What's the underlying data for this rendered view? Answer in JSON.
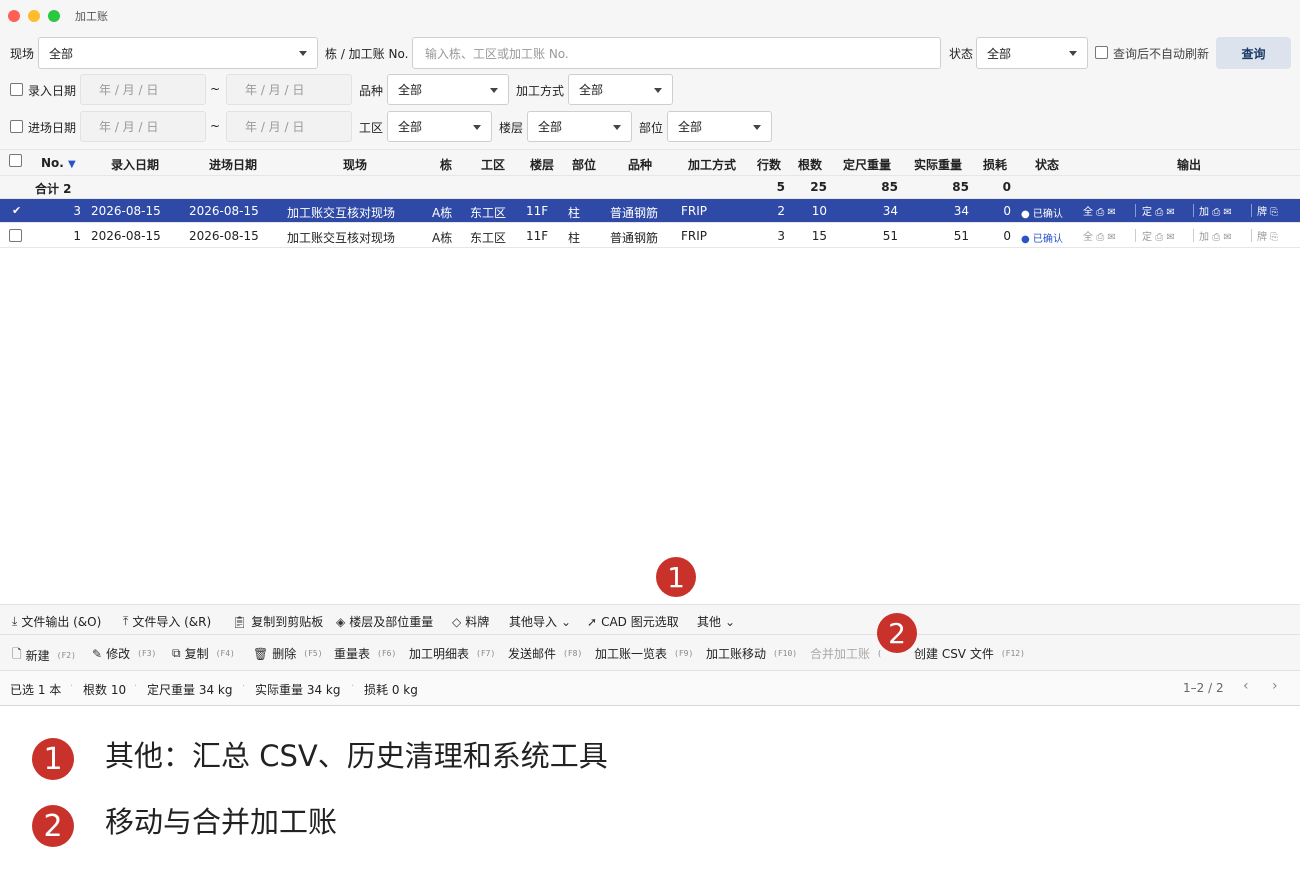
{
  "window": {
    "title": "加工账"
  },
  "filters": {
    "site_label": "现场",
    "site_value": "全部",
    "building_label": "栋 / 加工账 No.",
    "building_placeholder": "输入栋、工区或加工账 No.",
    "status_label": "状态",
    "status_value": "全部",
    "no_refresh_label": "查询后不自动刷新",
    "query_button": "查询",
    "entry_date_label": "录入日期",
    "arrival_date_label": "进场日期",
    "date_placeholder": "年 / 月 / 日",
    "tilde": "~",
    "variety_label": "品种",
    "variety_value": "全部",
    "method_label": "加工方式",
    "method_value": "全部",
    "zone_label": "工区",
    "zone_value": "全部",
    "floor_label": "楼层",
    "floor_value": "全部",
    "part_label": "部位",
    "part_value": "全部"
  },
  "table": {
    "headers": {
      "no": "No.",
      "entry": "录入日期",
      "arrival": "进场日期",
      "site": "现场",
      "bldg": "栋",
      "zone": "工区",
      "floor": "楼层",
      "part": "部位",
      "variety": "品种",
      "method": "加工方式",
      "rows": "行数",
      "count": "根数",
      "fixed": "定尺重量",
      "actual": "实际重量",
      "loss": "损耗",
      "status": "状态",
      "output": "输出"
    },
    "sort_indicator": "▼",
    "summary": {
      "label": "合计 2",
      "rows": "5",
      "count": "25",
      "fixed": "85",
      "actual": "85",
      "loss": "0"
    },
    "rows": [
      {
        "no": "3",
        "entry": "2026-08-15",
        "arrival": "2026-08-15",
        "site": "加工账交互核对现场",
        "bldg": "A栋",
        "zone": "东工区",
        "floor": "11F",
        "part": "柱",
        "variety": "普通钢筋",
        "method": "FRIP",
        "rows": "2",
        "count": "10",
        "fixed": "34",
        "actual": "34",
        "loss": "0",
        "status": "● 已确认",
        "selected": true
      },
      {
        "no": "1",
        "entry": "2026-08-15",
        "arrival": "2026-08-15",
        "site": "加工账交互核对现场",
        "bldg": "A栋",
        "zone": "东工区",
        "floor": "11F",
        "part": "柱",
        "variety": "普通钢筋",
        "method": "FRIP",
        "rows": "3",
        "count": "15",
        "fixed": "51",
        "actual": "51",
        "loss": "0",
        "status": "● 已确认",
        "selected": false
      }
    ],
    "output_groups": {
      "all": "全",
      "fixed": "定",
      "proc": "加",
      "tag": "牌"
    }
  },
  "toolbar1": {
    "file_out": "文件输出 (&O)",
    "file_in": "文件导入 (&R)",
    "copy_clip": "复制到剪贴板",
    "floor_weight": "楼层及部位重量",
    "tag": "料牌",
    "other_import": "其他导入",
    "cad": "CAD 图元选取",
    "other": "其他"
  },
  "toolbar2": {
    "new": "新建",
    "new_key": "(F2)",
    "edit": "修改",
    "edit_key": "(F3)",
    "copy": "复制",
    "copy_key": "(F4)",
    "delete": "删除",
    "delete_key": "(F5)",
    "weight_table": "重量表",
    "weight_key": "(F6)",
    "detail": "加工明细表",
    "detail_key": "(F7)",
    "mail": "发送邮件",
    "mail_key": "(F8)",
    "list": "加工账一览表",
    "list_key": "(F9)",
    "move": "加工账移动",
    "move_key": "(F10)",
    "merge": "合并加工账",
    "merge_key": "(",
    "csv": "创建 CSV 文件",
    "csv_key": "(F12)"
  },
  "statusbar": {
    "selected": "已选 1 本",
    "count": "根数 10",
    "fixed": "定尺重量 34 kg",
    "actual": "实际重量 34 kg",
    "loss": "损耗 0 kg",
    "page": "1–2 / 2"
  },
  "callouts": [
    {
      "num": "1",
      "text": "其他：汇总 CSV、历史清理和系统工具"
    },
    {
      "num": "2",
      "text": "移动与合并加工账"
    }
  ],
  "colors": {
    "selected_row": "#2f4aa6",
    "badge": "#c8322b",
    "confirmed": "#2a53c8"
  }
}
